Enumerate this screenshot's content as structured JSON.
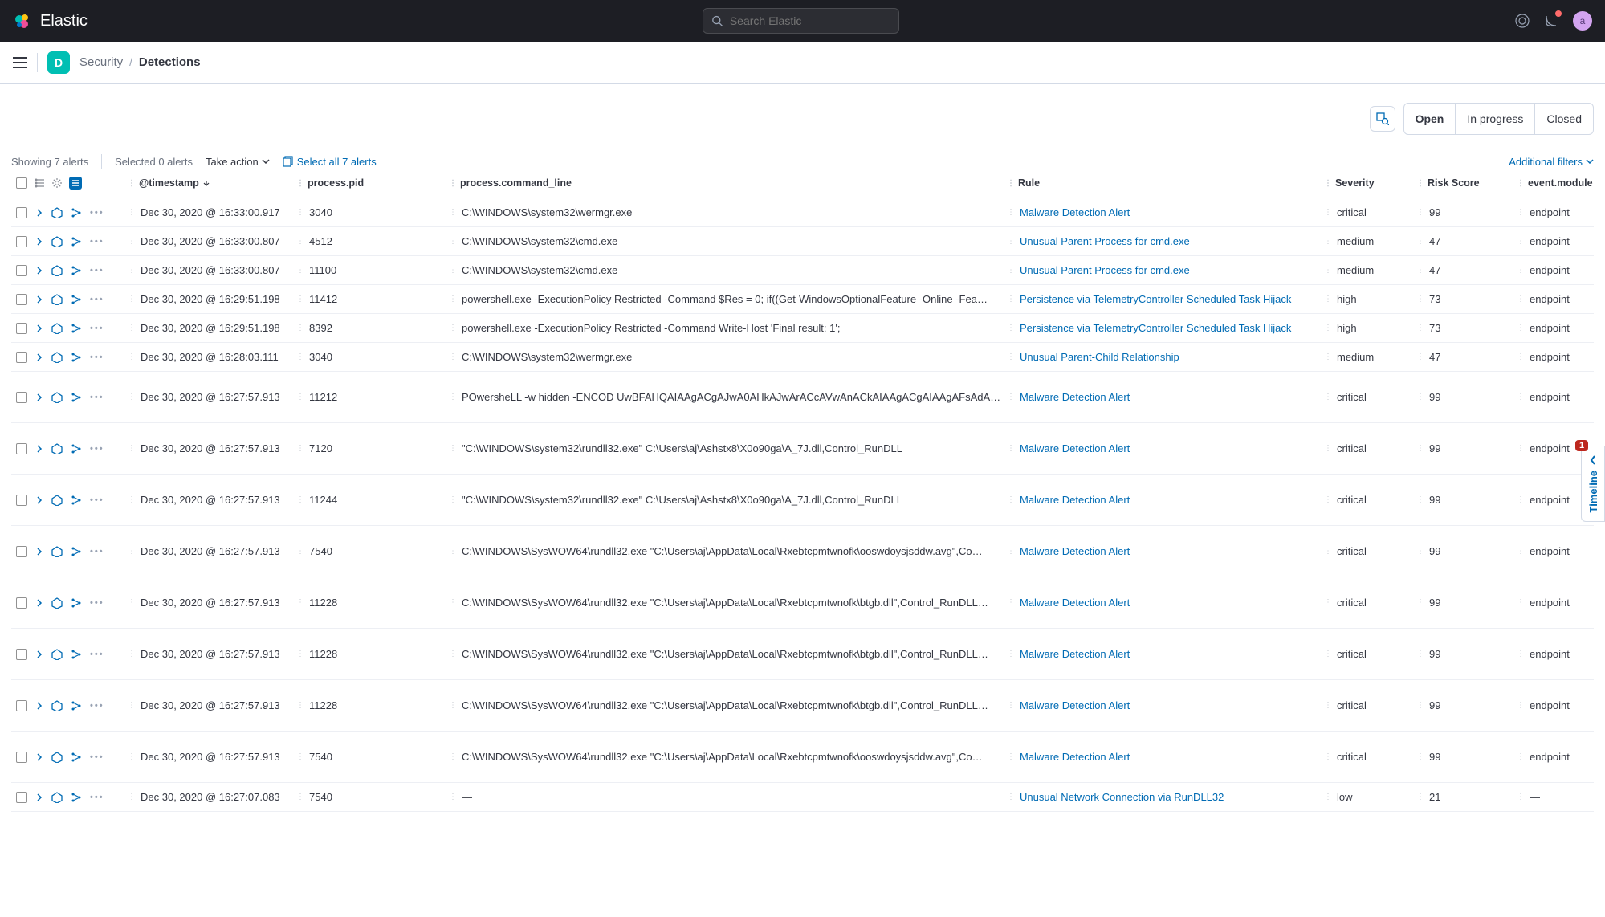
{
  "header": {
    "brand": "Elastic",
    "search_placeholder": "Search Elastic",
    "avatar_letter": "a",
    "space_letter": "D"
  },
  "breadcrumb": {
    "parent": "Security",
    "current": "Detections"
  },
  "filters": {
    "open": "Open",
    "in_progress": "In progress",
    "closed": "Closed",
    "additional": "Additional filters"
  },
  "controls": {
    "showing": "Showing 7 alerts",
    "selected": "Selected 0 alerts",
    "take_action": "Take action",
    "select_all": "Select all 7 alerts"
  },
  "columns": {
    "timestamp": "@timestamp",
    "pid": "process.pid",
    "cmd": "process.command_line",
    "rule": "Rule",
    "severity": "Severity",
    "risk": "Risk Score",
    "module": "event.module"
  },
  "timeline": {
    "label": "Timeline",
    "badge": "1"
  },
  "rows": [
    {
      "ts": "Dec 30, 2020 @ 16:33:00.917",
      "pid": "3040",
      "cmd": "C:\\WINDOWS\\system32\\wermgr.exe",
      "rule": "Malware Detection Alert",
      "sev": "critical",
      "risk": "99",
      "mod": "endpoint",
      "tall": false
    },
    {
      "ts": "Dec 30, 2020 @ 16:33:00.807",
      "pid": "4512",
      "cmd": "C:\\WINDOWS\\system32\\cmd.exe",
      "rule": "Unusual Parent Process for cmd.exe",
      "sev": "medium",
      "risk": "47",
      "mod": "endpoint",
      "tall": false
    },
    {
      "ts": "Dec 30, 2020 @ 16:33:00.807",
      "pid": "11100",
      "cmd": "C:\\WINDOWS\\system32\\cmd.exe",
      "rule": "Unusual Parent Process for cmd.exe",
      "sev": "medium",
      "risk": "47",
      "mod": "endpoint",
      "tall": false
    },
    {
      "ts": "Dec 30, 2020 @ 16:29:51.198",
      "pid": "11412",
      "cmd": "powershell.exe -ExecutionPolicy Restricted -Command $Res = 0; if((Get-WindowsOptionalFeature -Online -Fea…",
      "rule": "Persistence via TelemetryController Scheduled Task Hijack",
      "sev": "high",
      "risk": "73",
      "mod": "endpoint",
      "tall": false
    },
    {
      "ts": "Dec 30, 2020 @ 16:29:51.198",
      "pid": "8392",
      "cmd": "powershell.exe -ExecutionPolicy Restricted -Command Write-Host 'Final result: 1';",
      "rule": "Persistence via TelemetryController Scheduled Task Hijack",
      "sev": "high",
      "risk": "73",
      "mod": "endpoint",
      "tall": false
    },
    {
      "ts": "Dec 30, 2020 @ 16:28:03.111",
      "pid": "3040",
      "cmd": "C:\\WINDOWS\\system32\\wermgr.exe",
      "rule": "Unusual Parent-Child Relationship",
      "sev": "medium",
      "risk": "47",
      "mod": "endpoint",
      "tall": false
    },
    {
      "ts": "Dec 30, 2020 @ 16:27:57.913",
      "pid": "11212",
      "cmd": "POwersheLL -w hidden -ENCOD UwBFAHQAIAAgACgAJwA0AHkAJwArACcAVwAnACkAIAAgACgAIAAgAFsAdA…",
      "rule": "Malware Detection Alert",
      "sev": "critical",
      "risk": "99",
      "mod": "endpoint",
      "tall": true
    },
    {
      "ts": "Dec 30, 2020 @ 16:27:57.913",
      "pid": "7120",
      "cmd": "\"C:\\WINDOWS\\system32\\rundll32.exe\" C:\\Users\\aj\\Ashstx8\\X0o90ga\\A_7J.dll,Control_RunDLL",
      "rule": "Malware Detection Alert",
      "sev": "critical",
      "risk": "99",
      "mod": "endpoint",
      "tall": true
    },
    {
      "ts": "Dec 30, 2020 @ 16:27:57.913",
      "pid": "11244",
      "cmd": "\"C:\\WINDOWS\\system32\\rundll32.exe\" C:\\Users\\aj\\Ashstx8\\X0o90ga\\A_7J.dll,Control_RunDLL",
      "rule": "Malware Detection Alert",
      "sev": "critical",
      "risk": "99",
      "mod": "endpoint",
      "tall": true
    },
    {
      "ts": "Dec 30, 2020 @ 16:27:57.913",
      "pid": "7540",
      "cmd": "C:\\WINDOWS\\SysWOW64\\rundll32.exe \"C:\\Users\\aj\\AppData\\Local\\Rxebtcpmtwnofk\\ooswdoysjsddw.avg\",Co…",
      "rule": "Malware Detection Alert",
      "sev": "critical",
      "risk": "99",
      "mod": "endpoint",
      "tall": true
    },
    {
      "ts": "Dec 30, 2020 @ 16:27:57.913",
      "pid": "11228",
      "cmd": "C:\\WINDOWS\\SysWOW64\\rundll32.exe \"C:\\Users\\aj\\AppData\\Local\\Rxebtcpmtwnofk\\btgb.dll\",Control_RunDLL…",
      "rule": "Malware Detection Alert",
      "sev": "critical",
      "risk": "99",
      "mod": "endpoint",
      "tall": true
    },
    {
      "ts": "Dec 30, 2020 @ 16:27:57.913",
      "pid": "11228",
      "cmd": "C:\\WINDOWS\\SysWOW64\\rundll32.exe \"C:\\Users\\aj\\AppData\\Local\\Rxebtcpmtwnofk\\btgb.dll\",Control_RunDLL…",
      "rule": "Malware Detection Alert",
      "sev": "critical",
      "risk": "99",
      "mod": "endpoint",
      "tall": true
    },
    {
      "ts": "Dec 30, 2020 @ 16:27:57.913",
      "pid": "11228",
      "cmd": "C:\\WINDOWS\\SysWOW64\\rundll32.exe \"C:\\Users\\aj\\AppData\\Local\\Rxebtcpmtwnofk\\btgb.dll\",Control_RunDLL…",
      "rule": "Malware Detection Alert",
      "sev": "critical",
      "risk": "99",
      "mod": "endpoint",
      "tall": true
    },
    {
      "ts": "Dec 30, 2020 @ 16:27:57.913",
      "pid": "7540",
      "cmd": "C:\\WINDOWS\\SysWOW64\\rundll32.exe \"C:\\Users\\aj\\AppData\\Local\\Rxebtcpmtwnofk\\ooswdoysjsddw.avg\",Co…",
      "rule": "Malware Detection Alert",
      "sev": "critical",
      "risk": "99",
      "mod": "endpoint",
      "tall": true
    },
    {
      "ts": "Dec 30, 2020 @ 16:27:07.083",
      "pid": "7540",
      "cmd": "—",
      "rule": "Unusual Network Connection via RunDLL32",
      "sev": "low",
      "risk": "21",
      "mod": "—",
      "tall": false
    }
  ]
}
